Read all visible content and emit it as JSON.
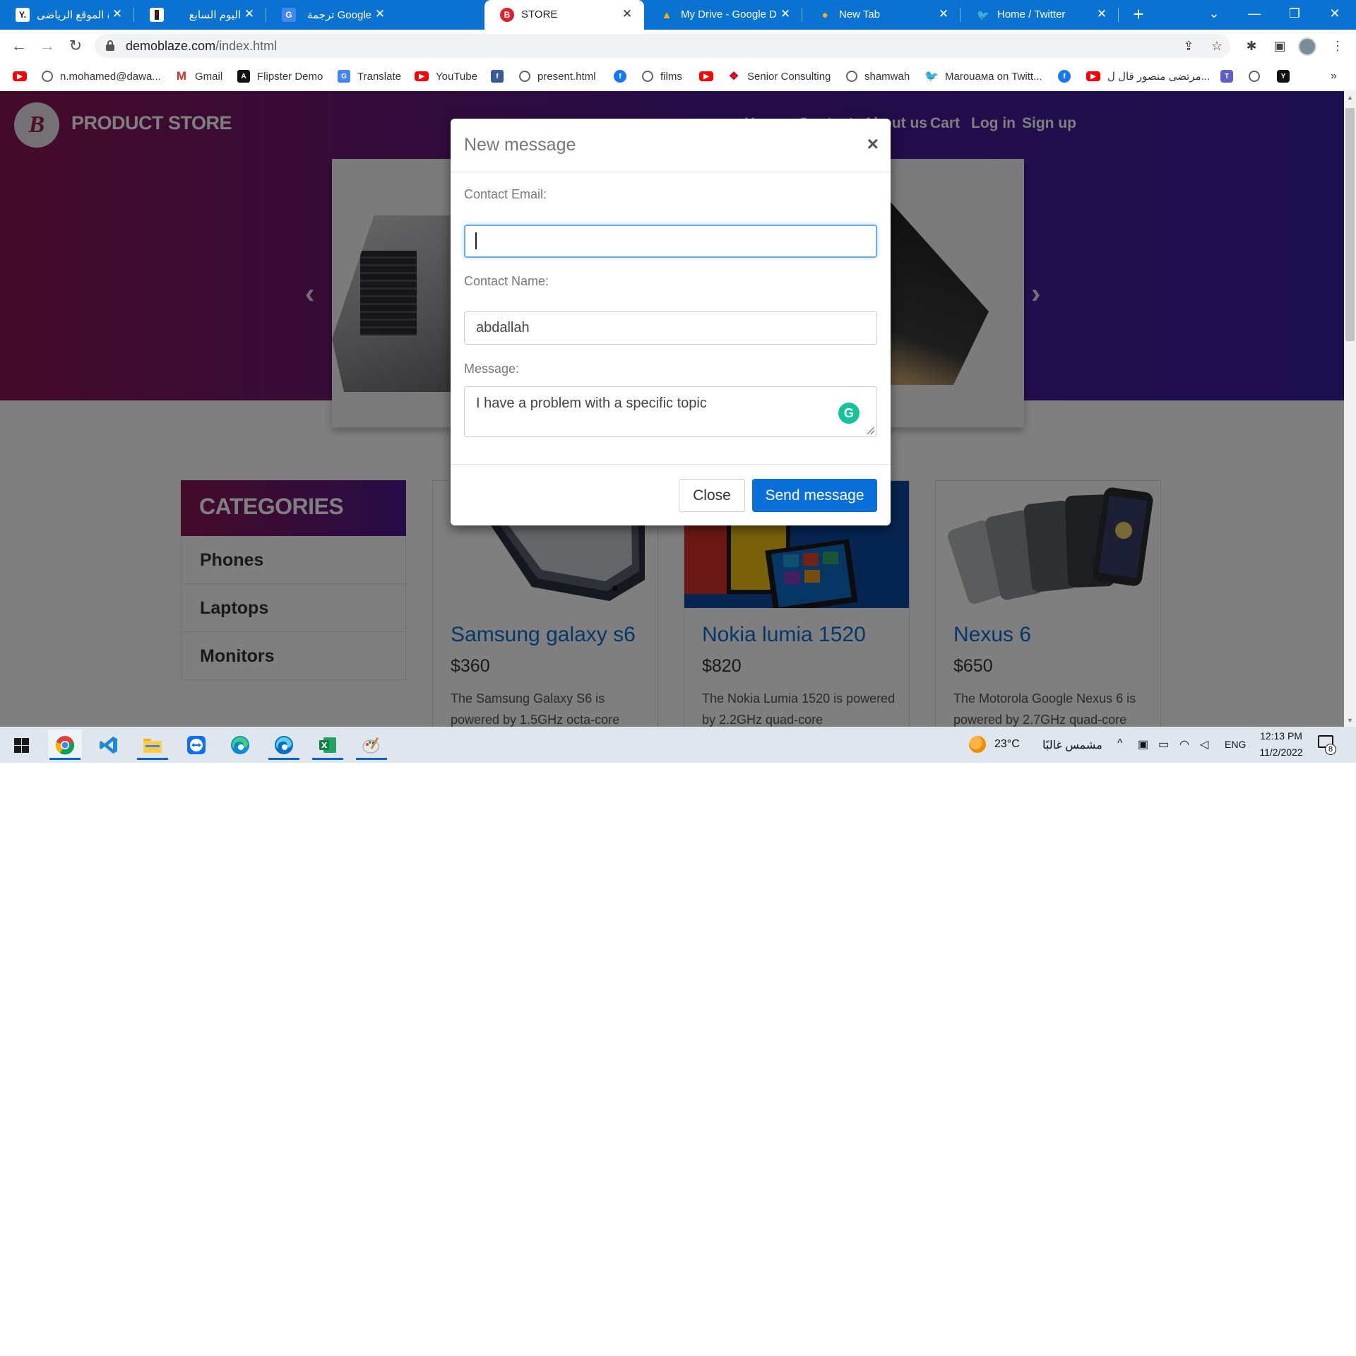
{
  "browser": {
    "tabs": [
      {
        "title": "يلاكورة الموقع الرياضى",
        "icon": "yallakora-icon",
        "favicon_text": "Y."
      },
      {
        "title": "اليوم السابع",
        "icon": "youm7-icon",
        "favicon_text": ""
      },
      {
        "title": "ترجمة Google",
        "icon": "google-translate-icon",
        "favicon_text": "G"
      },
      {
        "title": "STORE",
        "icon": "store-icon",
        "favicon_text": "B",
        "active": true
      },
      {
        "title": "My Drive - Google Drive",
        "icon": "google-drive-icon",
        "favicon_text": "▲"
      },
      {
        "title": "New Tab",
        "icon": "newtab-icon",
        "favicon_text": "●"
      },
      {
        "title": "Home / Twitter",
        "icon": "twitter-icon",
        "favicon_text": "🐦"
      }
    ],
    "tab_close_glyph": "✕",
    "new_tab_glyph": "+",
    "window_controls": {
      "tab_search": "⌄",
      "minimize": "—",
      "restore": "❐",
      "close": "✕"
    },
    "nav": {
      "back": "←",
      "forward": "→",
      "reload": "↻"
    },
    "url": {
      "host": "demoblaze.com",
      "path": "/index.html"
    },
    "omnibox_icons": {
      "share": "⇪",
      "star": "☆"
    },
    "toolbar_icons": {
      "extensions": "✱",
      "side_panel": "▣",
      "menu": "⋮"
    },
    "bookmarks": [
      {
        "label": "",
        "icon": "youtube-icon",
        "glyph": "▶"
      },
      {
        "label": "n.mohamed@dawa...",
        "icon": "globe-icon",
        "glyph": ""
      },
      {
        "label": "Gmail",
        "icon": "gmail-icon",
        "glyph": "M"
      },
      {
        "label": "Flipster Demo",
        "icon": "flipster-icon",
        "glyph": "A"
      },
      {
        "label": "Translate",
        "icon": "translate-icon",
        "glyph": "G"
      },
      {
        "label": "YouTube",
        "icon": "youtube-icon",
        "glyph": "▶"
      },
      {
        "label": "",
        "icon": "facebook-icon",
        "glyph": "f"
      },
      {
        "label": "present.html",
        "icon": "globe-icon",
        "glyph": ""
      },
      {
        "label": "",
        "icon": "facebook-icon",
        "glyph": "f"
      },
      {
        "label": "films",
        "icon": "globe-icon",
        "glyph": ""
      },
      {
        "label": "",
        "icon": "youtube-icon",
        "glyph": "▶"
      },
      {
        "label": "Senior Consulting",
        "icon": "senior-consulting-icon",
        "glyph": "❖"
      },
      {
        "label": "shamwah",
        "icon": "globe-icon",
        "glyph": ""
      },
      {
        "label": "Marouaмa on Twitt...",
        "icon": "twitter-icon",
        "glyph": "🐦"
      },
      {
        "label": "",
        "icon": "facebook-icon",
        "glyph": "f"
      },
      {
        "label": "مرتضى منصور قال ل...",
        "icon": "youtube-icon",
        "glyph": "▶"
      },
      {
        "label": "",
        "icon": "teams-icon",
        "glyph": "T"
      },
      {
        "label": "",
        "icon": "globe-icon",
        "glyph": ""
      },
      {
        "label": "",
        "icon": "y-icon",
        "glyph": "Y"
      }
    ],
    "bookmarks_overflow": "»"
  },
  "site": {
    "logo_glyph": "B",
    "brand": "PRODUCT STORE",
    "nav": [
      "Home",
      "Contact",
      "About us",
      "Cart",
      "Log in",
      "Sign up"
    ],
    "carousel_prev": "‹",
    "carousel_next": "›",
    "categories": {
      "title": "CATEGORIES",
      "items": [
        "Phones",
        "Laptops",
        "Monitors"
      ]
    },
    "products": [
      {
        "name": "Samsung galaxy s6",
        "price": "$360",
        "desc": "The Samsung Galaxy S6 is powered by 1.5GHz octa-core"
      },
      {
        "name": "Nokia lumia 1520",
        "price": "$820",
        "desc": "The Nokia Lumia 1520 is powered by 2.2GHz quad-core"
      },
      {
        "name": "Nexus 6",
        "price": "$650",
        "desc": "The Motorola Google Nexus 6 is powered by 2.7GHz quad-core"
      }
    ]
  },
  "modal": {
    "title": "New message",
    "close_glyph": "×",
    "email_label": "Contact Email:",
    "email_value": "",
    "name_label": "Contact Name:",
    "name_value": "abdallah",
    "message_label": "Message:",
    "message_value": "I have a problem with a specific topic",
    "grammarly_glyph": "G",
    "close_button": "Close",
    "send_button": "Send message"
  },
  "taskbar": {
    "apps": [
      {
        "name": "chrome-icon",
        "active": true
      },
      {
        "name": "vscode-icon"
      },
      {
        "name": "file-explorer-icon"
      },
      {
        "name": "teamviewer-icon"
      },
      {
        "name": "edge-icon"
      },
      {
        "name": "edge-dev-icon"
      },
      {
        "name": "excel-icon"
      },
      {
        "name": "paint-icon"
      }
    ],
    "weather_temp": "23°C",
    "weather_desc": "مشمس غالبًا",
    "tray_chevron": "^",
    "language": "ENG",
    "time": "12:13 PM",
    "date": "11/2/2022",
    "notification_count": "8"
  },
  "colors": {
    "chrome_tabstrip": "#0a72d0",
    "hero_gradient_start": "#8a1552",
    "hero_gradient_end": "#3a1d9e",
    "link_blue": "#0a6fcf",
    "send_button": "#0a6fd8"
  }
}
